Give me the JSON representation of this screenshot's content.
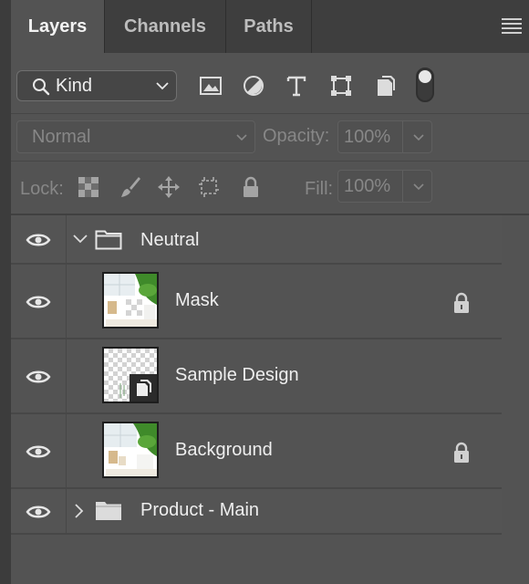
{
  "tabs": [
    {
      "label": "Layers",
      "active": true
    },
    {
      "label": "Channels",
      "active": false
    },
    {
      "label": "Paths",
      "active": false
    }
  ],
  "filter": {
    "kind_label": "Kind",
    "icons": [
      "image-filter-icon",
      "adjustment-filter-icon",
      "type-filter-icon",
      "shape-filter-icon",
      "smart-object-filter-icon"
    ],
    "toggle_on": true
  },
  "blend": {
    "mode": "Normal",
    "opacity_label": "Opacity:",
    "opacity_value": "100%"
  },
  "lock": {
    "label": "Lock:",
    "fill_label": "Fill:",
    "fill_value": "100%",
    "icons": [
      "lock-transparent-pixels-icon",
      "lock-image-pixels-icon",
      "lock-position-icon",
      "lock-artboard-icon",
      "lock-all-icon"
    ]
  },
  "layers": [
    {
      "name": "Neutral",
      "type": "group",
      "expanded": true,
      "visible": true
    },
    {
      "name": "Mask",
      "type": "image",
      "locked": true,
      "visible": true
    },
    {
      "name": "Sample Design",
      "type": "smart-object",
      "locked": false,
      "visible": true
    },
    {
      "name": "Background",
      "type": "image",
      "locked": true,
      "visible": true
    },
    {
      "name": "Product - Main",
      "type": "group",
      "expanded": false,
      "visible": true
    }
  ],
  "colors": {
    "panel_bg": "#535353",
    "tabbar_bg": "#3e3e3e",
    "text": "#e6e6e6",
    "dim_text": "#878787"
  }
}
